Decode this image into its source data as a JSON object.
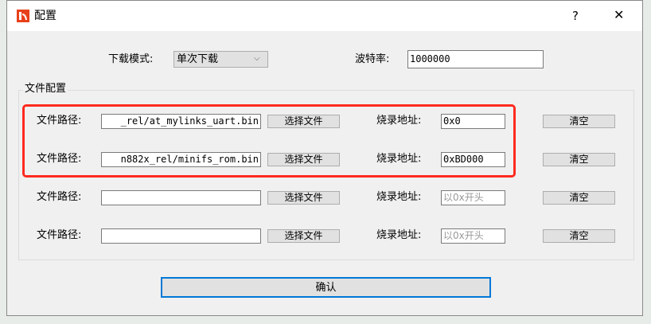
{
  "window": {
    "title": "配置",
    "help": "?",
    "close": "✕"
  },
  "mode": {
    "label": "下载模式:",
    "value": "单次下载"
  },
  "baud": {
    "label": "波特率:",
    "value": "1000000"
  },
  "group": {
    "title": "文件配置"
  },
  "rows": [
    {
      "path_label": "文件路径:",
      "path": "_rel/at_mylinks_uart.bin",
      "choose": "选择文件",
      "addr_label": "烧录地址:",
      "addr": "0x0",
      "addr_placeholder": "以0x开头",
      "clear": "清空"
    },
    {
      "path_label": "文件路径:",
      "path": "n882x_rel/minifs_rom.bin",
      "choose": "选择文件",
      "addr_label": "烧录地址:",
      "addr": "0xBD000",
      "addr_placeholder": "以0x开头",
      "clear": "清空"
    },
    {
      "path_label": "文件路径:",
      "path": "",
      "choose": "选择文件",
      "addr_label": "烧录地址:",
      "addr": "",
      "addr_placeholder": "以0x开头",
      "clear": "清空"
    },
    {
      "path_label": "文件路径:",
      "path": "",
      "choose": "选择文件",
      "addr_label": "烧录地址:",
      "addr": "",
      "addr_placeholder": "以0x开头",
      "clear": "清空"
    }
  ],
  "confirm": "确认",
  "colors": {
    "highlight": "#ff2a1f",
    "focus": "#0078d7"
  }
}
